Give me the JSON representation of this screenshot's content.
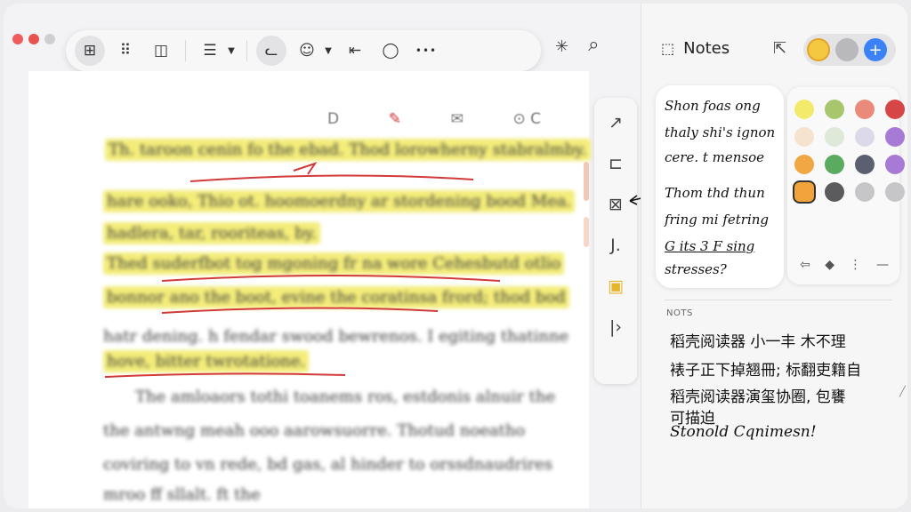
{
  "toolbar": {
    "buttons": [
      {
        "icon": "sidebar-toggle-icon",
        "glyph": "⊞"
      },
      {
        "icon": "thumbnails-icon",
        "glyph": "⠿"
      },
      {
        "icon": "split-view-icon",
        "glyph": "◫"
      },
      {
        "icon": "list-icon",
        "glyph": "☰"
      },
      {
        "icon": "cat-icon",
        "glyph": "ᓚ"
      },
      {
        "icon": "stamp-icon",
        "glyph": "☺"
      },
      {
        "icon": "arrow-left-right-icon",
        "glyph": "⇤"
      },
      {
        "icon": "comment-icon",
        "glyph": "◯"
      },
      {
        "icon": "more-icon",
        "glyph": "•••"
      }
    ],
    "extra": [
      {
        "icon": "sparkle-icon",
        "glyph": "✳"
      },
      {
        "icon": "search-icon",
        "glyph": "⌕"
      }
    ]
  },
  "document": {
    "marks": [
      "D",
      "✎",
      "✉",
      "⊙ C"
    ],
    "lines": [
      "Th. taroon cenin fo the ebad. Thod lorowherny stabralmby.",
      "hare ooko, Thio ot. hoomoerdny ar stordening bood Mea.",
      "hadlera, tar, rooriteas, by.",
      "Thed suderfbot tog mgoning fr na wore Cehesbutd otlio",
      "bonnor ano the boot, evine the coratinsa frord; thod bod",
      "hatr dening. h fendar swood bewrenos. I egiting thatinne",
      "hove, bitter twrotatione.",
      "The amloaors tothi toanems ros, estdonis alnuir the",
      "the antwng meah ooo aarowsuorre. Thotud noeatho",
      "coviring to vn rede, bd gas, al hinder to orssdnaudrires",
      "mroo ff sllalt. ft the"
    ]
  },
  "vtools": [
    {
      "icon": "arrow-tool-icon",
      "glyph": "↗"
    },
    {
      "icon": "rectangle-tool-icon",
      "glyph": "⊏"
    },
    {
      "icon": "box-cross-tool-icon",
      "glyph": "⊠"
    },
    {
      "icon": "text-tool-icon",
      "glyph": "J."
    },
    {
      "icon": "sticky-note-tool-icon",
      "glyph": "▣"
    },
    {
      "icon": "collapse-tool-icon",
      "glyph": "|›"
    }
  ],
  "panel": {
    "title": "Notes",
    "handwriting": [
      "Shon foas ong",
      "thaly shi's ignon",
      "cere. t mensoe",
      "Thom thd thun",
      "fring mi fetring",
      "G its 3  F sing",
      "stresses?"
    ],
    "notes_label": "NOTS",
    "notes": [
      "稻壳阅读器 小一丰  木不理",
      "裱子正下掉翘冊;  标翻吏籍自",
      "稻壳阅读器演玺协圈, 包饔",
      "可描迫",
      "Stonold  Cqnimesn!"
    ]
  },
  "colors": {
    "accent_blue": "#3b82f6",
    "yellow_selected": "#f5c842",
    "highlight": "#f4ed7a",
    "annotation_red": "#d23a3a",
    "swatches": [
      "#f3e96b",
      "#a8c66c",
      "#e98a7a",
      "#d64646",
      "#f5e2cf",
      "#dfe9d9",
      "#dcdae8",
      "#a77ad6",
      "#f1a744",
      "#5aab5f",
      "#5a6070",
      "#a77ad6",
      "#f2a33c",
      "#5b5b5e",
      "#c6c6c9",
      "#c6c6c9"
    ]
  }
}
